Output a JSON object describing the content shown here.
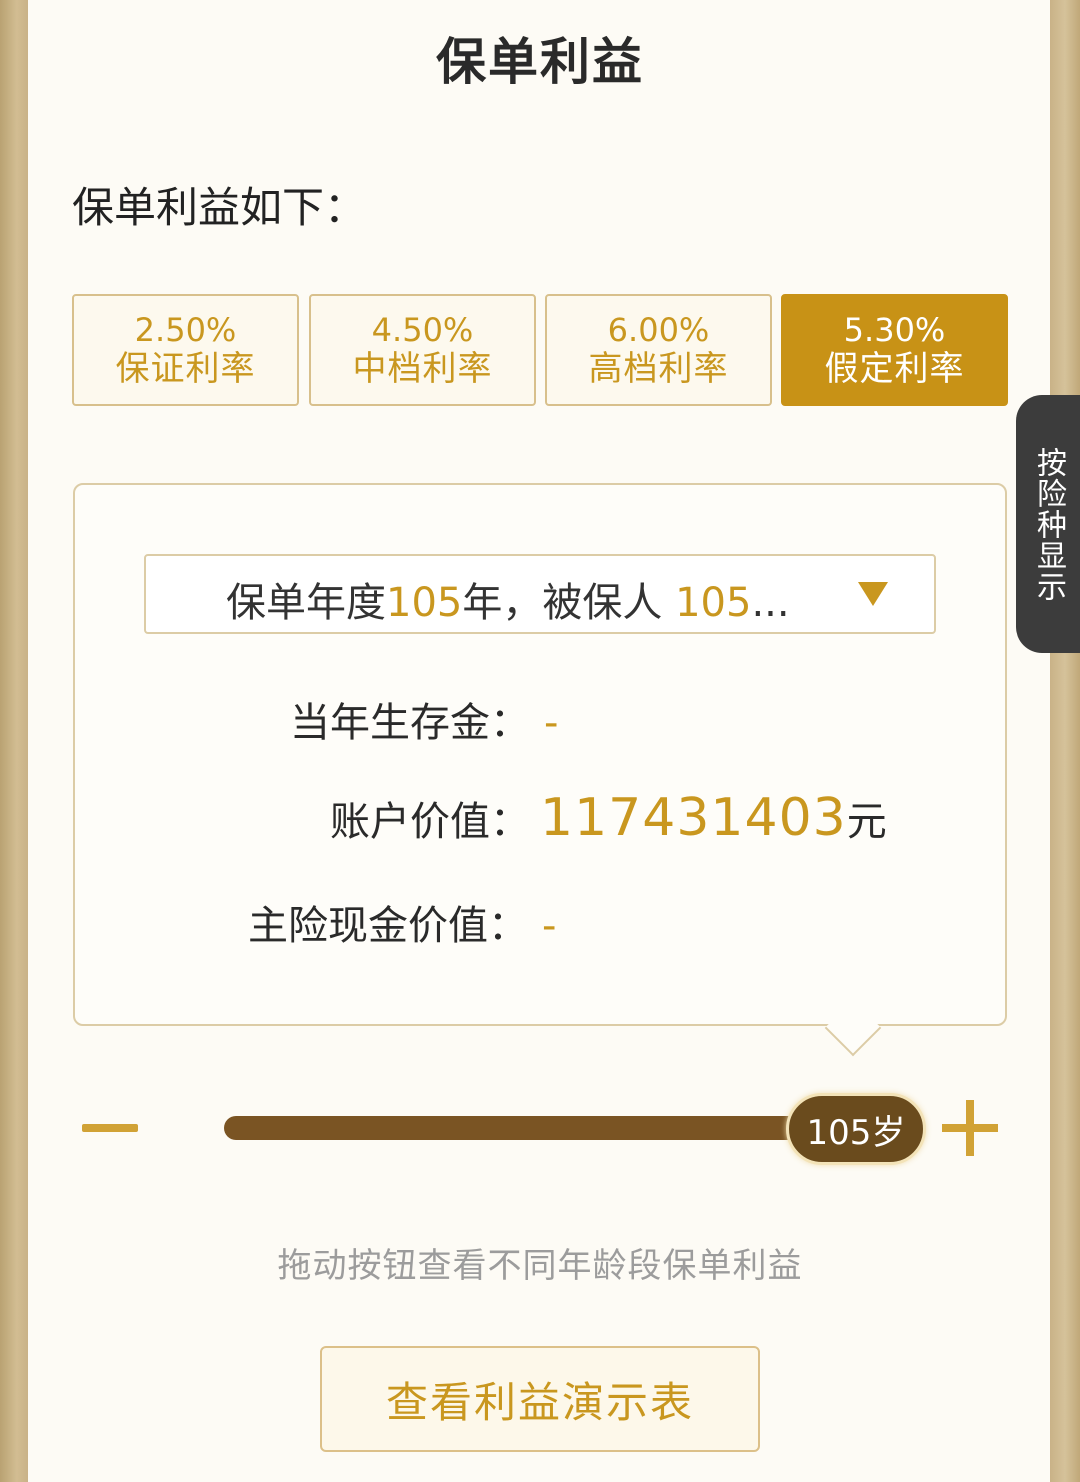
{
  "header": {
    "title": "保单利益"
  },
  "intro": {
    "label": "保单利益如下："
  },
  "rates": [
    {
      "value": "2.50%",
      "label": "保证利率",
      "active": false
    },
    {
      "value": "4.50%",
      "label": "中档利率",
      "active": false
    },
    {
      "value": "6.00%",
      "label": "高档利率",
      "active": false
    },
    {
      "value": "5.30%",
      "label": "假定利率",
      "active": true
    }
  ],
  "side_tab": {
    "label": "按险种显示"
  },
  "selector": {
    "prefix": "保单年度",
    "year": "105",
    "mid": "年，被保人",
    "age": "105",
    "suffix": "..."
  },
  "details": {
    "survival_label": "当年生存金：",
    "survival_value": "-",
    "account_label": "账户价值：",
    "account_value": "117431403",
    "account_unit": "元",
    "cash_label": "主险现金价值：",
    "cash_value": "-"
  },
  "slider": {
    "thumb_label": "105岁",
    "progress": 1.0
  },
  "hint": "拖动按钮查看不同年龄段保单利益",
  "actions": {
    "table_button": "查看利益演示表"
  },
  "colors": {
    "accent": "#c89216",
    "thumb": "#6a4b1d",
    "track": "#7a5423"
  }
}
